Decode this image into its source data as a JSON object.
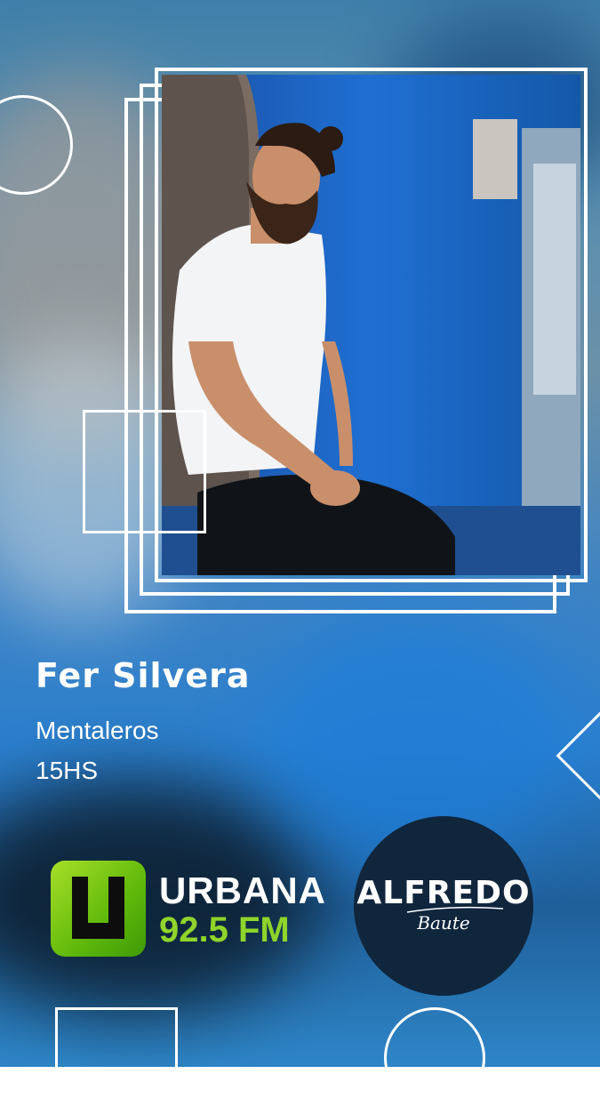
{
  "profile": {
    "name": "Fer Silvera",
    "show": "Mentaleros",
    "time": "15HS"
  },
  "logos": {
    "urbana_line1": "URBANA",
    "urbana_line2": "92.5 FM",
    "alfredo_line1": "ALFREDO",
    "alfredo_line2": "Baute"
  },
  "colors": {
    "urbana_green": "#7cc61a",
    "alfredo_navy": "#10263d",
    "wall_blue": "#1c5fb8"
  }
}
